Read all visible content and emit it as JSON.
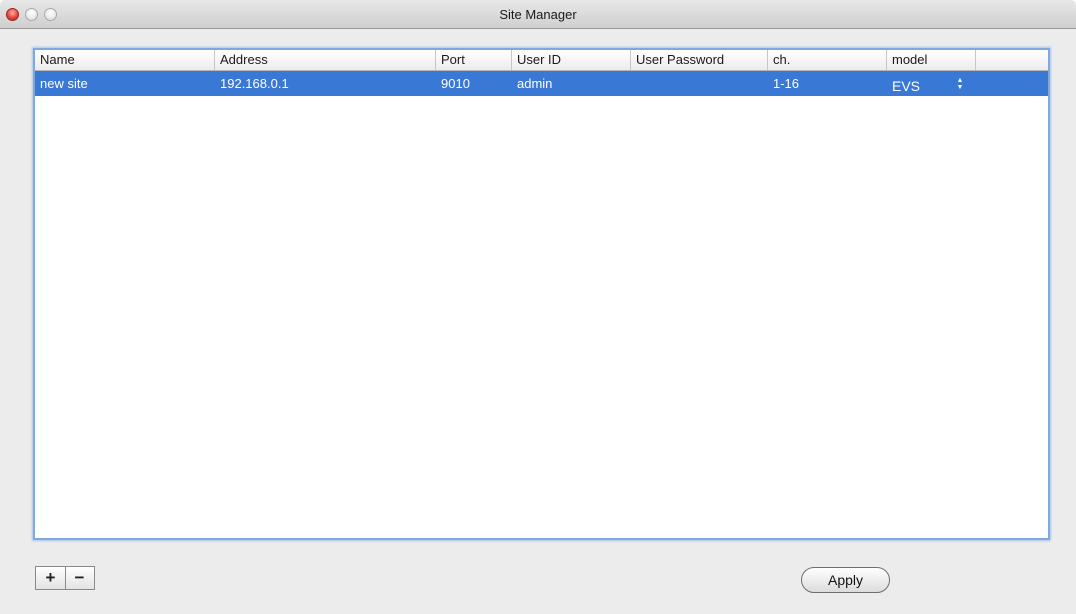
{
  "window": {
    "title": "Site Manager"
  },
  "table": {
    "columns": [
      "Name",
      "Address",
      "Port",
      "User ID",
      "User Password",
      "ch.",
      "model"
    ],
    "rows": [
      {
        "name": "new site",
        "address": "192.168.0.1",
        "port": "9010",
        "user_id": "admin",
        "user_password": "",
        "ch": "1-16",
        "model": "EVS"
      }
    ]
  },
  "controls": {
    "add_label": "+",
    "remove_label": "−",
    "apply_label": "Apply",
    "stepper_up": "▲",
    "stepper_down": "▼"
  },
  "colors": {
    "selection": "#3a78d6",
    "focus_ring": "#7fa8de",
    "close_button": "#e5463b"
  },
  "icons": [
    "close-icon",
    "minimize-icon",
    "zoom-icon",
    "stepper-icon",
    "add-icon",
    "remove-icon"
  ]
}
